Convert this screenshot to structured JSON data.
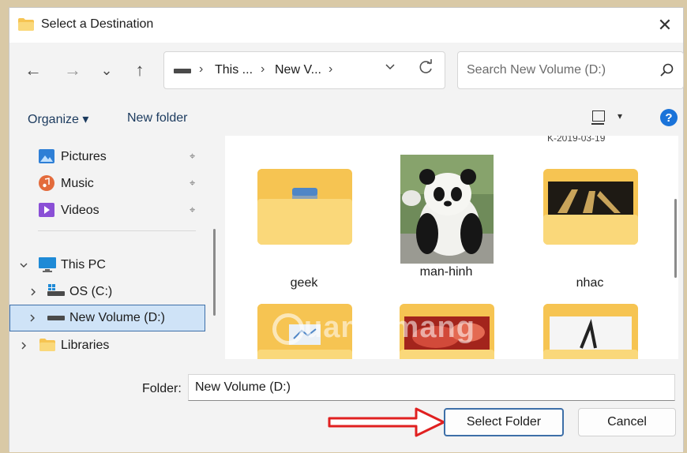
{
  "window": {
    "title": "Select a Destination",
    "close_glyph": "✕"
  },
  "nav": {
    "back_glyph": "←",
    "forward_glyph": "→",
    "recent_glyph": "⌄",
    "up_glyph": "↑"
  },
  "address": {
    "parts": [
      "This ...",
      "New V..."
    ],
    "separator": "›"
  },
  "search": {
    "placeholder": "Search New Volume (D:)"
  },
  "toolbar": {
    "organize": "Organize ▾",
    "new_folder": "New folder",
    "view_dropdown": "▾",
    "help": "?"
  },
  "sidebar": {
    "items": [
      {
        "label": "Pictures",
        "icon": "pictures-icon"
      },
      {
        "label": "Music",
        "icon": "music-icon"
      },
      {
        "label": "Videos",
        "icon": "videos-icon"
      },
      {
        "label": "This PC",
        "icon": "computer-icon"
      },
      {
        "label": "OS (C:)",
        "icon": "drive-icon"
      },
      {
        "label": "New Volume (D:)",
        "icon": "drive-icon"
      },
      {
        "label": "Libraries",
        "icon": "folder-icon"
      }
    ],
    "pin_glyph": "📌"
  },
  "content": {
    "cut_label": "K-2019-03-19",
    "items": [
      {
        "label": "geek",
        "type": "folder"
      },
      {
        "label": "man-hinh",
        "type": "image"
      },
      {
        "label": "nhac",
        "type": "folder"
      },
      {
        "label": "",
        "type": "folder"
      },
      {
        "label": "",
        "type": "folder"
      },
      {
        "label": "",
        "type": "folder"
      }
    ],
    "watermark": "uantrimang"
  },
  "bottom": {
    "folder_label": "Folder:",
    "folder_value": "New Volume (D:)",
    "select_button": "Select Folder",
    "cancel_button": "Cancel"
  },
  "colors": {
    "accent": "#1a73d9",
    "folder": "#f6c452",
    "arrow": "#e02020"
  }
}
